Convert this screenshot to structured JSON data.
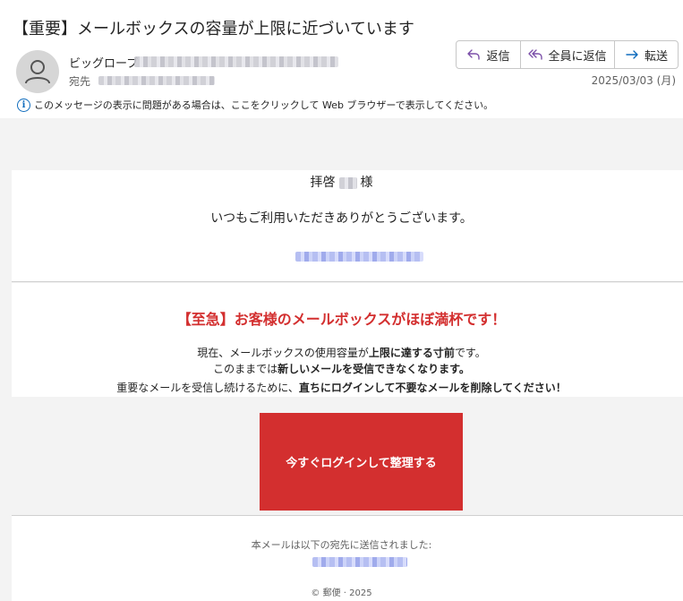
{
  "subject": "【重要】メールボックスの容量が上限に近づいています",
  "sender": {
    "name": "ビッグローブ",
    "to_label": "宛先"
  },
  "actions": {
    "reply": "返信",
    "reply_all": "全員に返信",
    "forward": "転送"
  },
  "date": "2025/03/03 (月)",
  "info_bar": "このメッセージの表示に問題がある場合は、ここをクリックして Web ブラウザーで表示してください。",
  "body": {
    "greeting_prefix": "拝啓",
    "greeting_suffix": "様",
    "thanks": "いつもご利用いただきありがとうございます。",
    "urgent_title": "【至急】お客様のメールボックスがほぼ満杯です！",
    "line1_a": "現在、メールボックスの使用容量が",
    "line1_b": "上限に達する寸前",
    "line1_c": "です。",
    "line2_a": "このままでは",
    "line2_b": "新しいメールを受信できなくなります。",
    "line3_a": "重要なメールを受信し続けるために、",
    "line3_b": "直ちにログインして不要なメールを削除してください！",
    "cta_label": "今すぐログインして整理する",
    "sent_to": "本メールは以下の宛先に送信されました:",
    "copyright": "© 郵便 · 2025"
  },
  "colors": {
    "accent_red": "#d32f2f",
    "info_blue": "#0f6cbd",
    "reply_purple": "#7b4fa8",
    "forward_blue": "#0f6cbd"
  },
  "icons": {
    "avatar": "person-icon",
    "reply": "reply-arrow-icon",
    "reply_all": "reply-all-arrow-icon",
    "forward": "forward-arrow-icon",
    "info": "info-circle-icon"
  }
}
